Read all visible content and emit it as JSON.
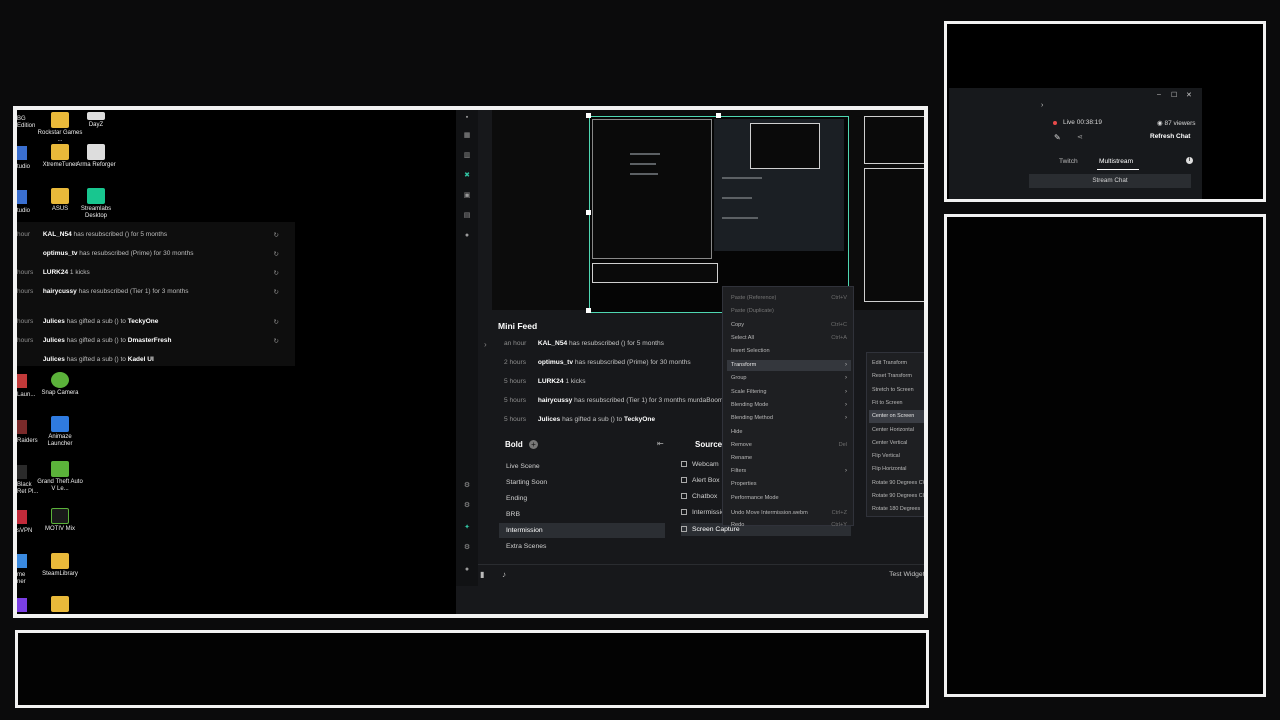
{
  "desktop": {
    "icons": [
      {
        "label": "Rockstar Games ...",
        "kind": "folder",
        "icon": "folder-icon"
      },
      {
        "label": "DayZ",
        "kind": "white",
        "icon": "dayz-icon"
      },
      {
        "label": "XtremeTuner",
        "kind": "folder",
        "icon": "folder-icon"
      },
      {
        "label": "Arma Reforger",
        "kind": "white",
        "icon": "arma-icon"
      },
      {
        "label": "ASUS",
        "kind": "folder",
        "icon": "folder-icon"
      },
      {
        "label": "Streamlabs Desktop",
        "kind": "green",
        "icon": "streamlabs-icon"
      },
      {
        "label": "Snap Camera",
        "kind": "lime",
        "icon": "snap-camera-icon"
      },
      {
        "label": "Animaze Launcher",
        "kind": "blue",
        "icon": "animaze-icon"
      },
      {
        "label": "Grand Theft Auto V Le...",
        "kind": "lime",
        "icon": "gta-icon"
      },
      {
        "label": "MOTIV Mix",
        "kind": "lime",
        "icon": "motiv-mix-icon"
      },
      {
        "label": "SteamLibrary",
        "kind": "folder",
        "icon": "folder-icon"
      },
      {
        "label": "",
        "kind": "folder",
        "icon": "folder-icon"
      }
    ],
    "side_labels": [
      "BG",
      "Edition",
      "tudio",
      "tudio",
      "Laun...",
      "Raiders",
      "Black",
      "Ret Pl...",
      "sVPN",
      "me",
      "ner"
    ]
  },
  "ghost_feed": [
    {
      "time": "hour",
      "user": "KAL_N54",
      "text": "has resubscribed () for 5 months"
    },
    {
      "time": "",
      "user": "optimus_tv",
      "text": "has resubscribed (Prime) for 30 months"
    },
    {
      "time": "hours",
      "user": "LURK24",
      "text": "1 kicks"
    },
    {
      "time": "hours",
      "user": "hairycussy",
      "text": "has resubscribed (Tier 1) for 3 months"
    },
    {
      "time": "hours",
      "user": "Julices",
      "text": "has gifted a sub () to",
      "target": "TeckyOne"
    },
    {
      "time": "hours",
      "user": "Julices",
      "text": "has gifted a sub () to",
      "target": "DmasterFresh"
    },
    {
      "time": "",
      "user": "Julices",
      "text": "has gifted a sub () to",
      "target": "Kadel Ul"
    }
  ],
  "mini_feed": {
    "title": "Mini Feed",
    "rows": [
      {
        "time": "an hour",
        "user": "KAL_N54",
        "text": "has resubscribed () for 5 months"
      },
      {
        "time": "2 hours",
        "user": "optimus_tv",
        "text": "has resubscribed (Prime) for 30 months"
      },
      {
        "time": "5 hours",
        "user": "LURK24",
        "text": "1 kicks"
      },
      {
        "time": "5 hours",
        "user": "hairycussy",
        "text": "has resubscribed (Tier 1) for 3 months murdaBoom"
      },
      {
        "time": "5 hours",
        "user": "Julices",
        "text": "has gifted a sub () to",
        "target": "TeckyOne"
      }
    ]
  },
  "scenes": {
    "title": "Bold",
    "items": [
      "Live Scene",
      "Starting Soon",
      "Ending",
      "BRB",
      "Intermission",
      "Extra Scenes"
    ],
    "active_index": 4
  },
  "sources": {
    "title": "Sources",
    "items": [
      "Webcam",
      "Alert Box",
      "Chatbox",
      "Intermission",
      "Screen Capture"
    ],
    "selected_index": 4
  },
  "footer": {
    "test_widgets": "Test Widgets"
  },
  "context_menu": {
    "items": [
      {
        "label": "Paste (Reference)",
        "shortcut": "Ctrl+V",
        "dim": true
      },
      {
        "label": "Paste (Duplicate)",
        "shortcut": "",
        "dim": true
      },
      {
        "label": "Copy",
        "shortcut": "Ctrl+C",
        "dim": false
      },
      {
        "label": "Select All",
        "shortcut": "Ctrl+A",
        "dim": false
      },
      {
        "label": "Invert Selection",
        "shortcut": "",
        "dim": false
      },
      {
        "label": "Transform",
        "shortcut": "",
        "submenu": true,
        "hl": true
      },
      {
        "label": "Group",
        "shortcut": "",
        "submenu": true
      },
      {
        "label": "Scale Filtering",
        "shortcut": "",
        "submenu": true
      },
      {
        "label": "Blending Mode",
        "shortcut": "",
        "submenu": true
      },
      {
        "label": "Blending Method",
        "shortcut": "",
        "submenu": true
      },
      {
        "label": "Hide",
        "shortcut": ""
      },
      {
        "label": "Remove",
        "shortcut": "Del"
      },
      {
        "label": "Rename",
        "shortcut": ""
      },
      {
        "label": "Filters",
        "shortcut": "",
        "submenu": true
      },
      {
        "label": "Properties",
        "shortcut": ""
      },
      {
        "label": "Performance Mode",
        "shortcut": ""
      },
      {
        "label": "Undo Move Intermission.webm",
        "shortcut": "Ctrl+Z"
      },
      {
        "label": "Redo",
        "shortcut": "Ctrl+Y"
      }
    ],
    "submenu": [
      "Edit Transform",
      "Reset Transform",
      "Stretch to Screen",
      "Fit to Screen",
      "Center on Screen",
      "Center Horizontal",
      "Center Vertical",
      "Flip Vertical",
      "Flip Horizontal",
      "Rotate 90 Degrees CW",
      "Rotate 90 Degrees CCW",
      "Rotate 180 Degrees"
    ],
    "submenu_hl_index": 4
  },
  "chat": {
    "live": "Live 00:38:19",
    "viewers": "87 viewers",
    "refresh": "Refresh Chat",
    "tab_twitch": "Twitch",
    "tab_multistream": "Multistream",
    "stream_chat": "Stream Chat"
  },
  "colors": {
    "accent": "#31c3a2",
    "live": "#e84a4a",
    "frame": "#f2f2f2"
  }
}
